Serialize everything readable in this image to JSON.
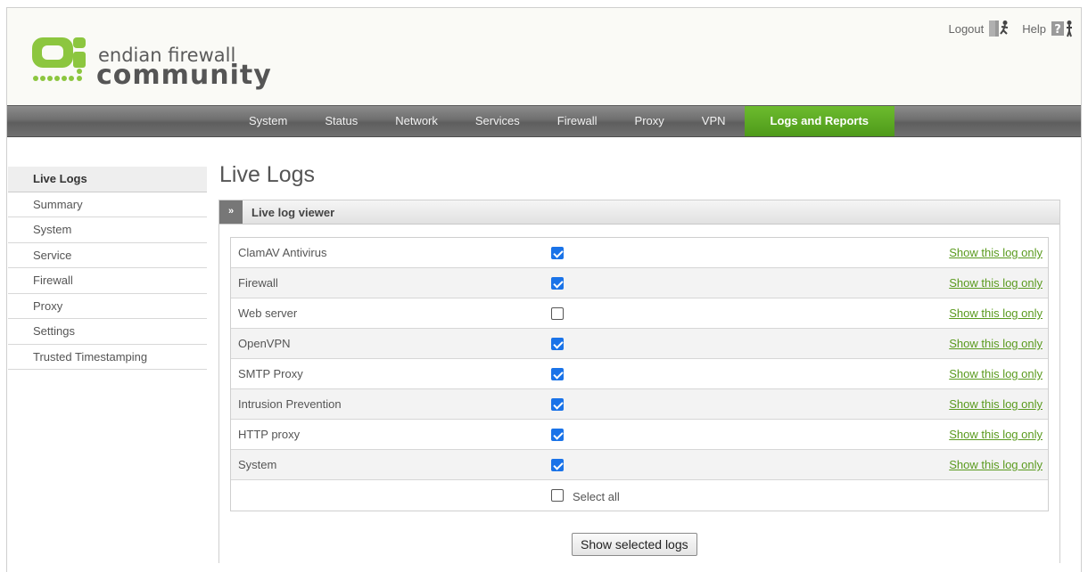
{
  "header": {
    "logo_line1": "endian firewall",
    "logo_line2": "community",
    "logout_label": "Logout",
    "help_label": "Help",
    "logout_icon": "exit-door-icon",
    "help_icon": "help-question-icon"
  },
  "nav": {
    "items": [
      {
        "label": "System"
      },
      {
        "label": "Status"
      },
      {
        "label": "Network"
      },
      {
        "label": "Services"
      },
      {
        "label": "Firewall"
      },
      {
        "label": "Proxy"
      },
      {
        "label": "VPN"
      },
      {
        "label": "Logs and Reports",
        "active": true
      }
    ],
    "active_color": "#5aa522"
  },
  "sidebar": {
    "items": [
      {
        "label": "Live Logs",
        "active": true
      },
      {
        "label": "Summary"
      },
      {
        "label": "System"
      },
      {
        "label": "Service"
      },
      {
        "label": "Firewall"
      },
      {
        "label": "Proxy"
      },
      {
        "label": "Settings"
      },
      {
        "label": "Trusted Timestamping"
      }
    ]
  },
  "main": {
    "title": "Live Logs",
    "panel_title": "Live log viewer",
    "panel_toggle": "»",
    "link_label": "Show this log only",
    "logs": [
      {
        "name": "ClamAV Antivirus",
        "checked": true
      },
      {
        "name": "Firewall",
        "checked": true
      },
      {
        "name": "Web server",
        "checked": false
      },
      {
        "name": "OpenVPN",
        "checked": true
      },
      {
        "name": "SMTP Proxy",
        "checked": true
      },
      {
        "name": "Intrusion Prevention",
        "checked": true
      },
      {
        "name": "HTTP proxy",
        "checked": true
      },
      {
        "name": "System",
        "checked": true
      }
    ],
    "select_all_label": "Select all",
    "select_all_checked": false,
    "submit_label": "Show selected logs"
  },
  "colors": {
    "link_green": "#5a9a1e",
    "checkbox_blue": "#1a73e8",
    "logo_green": "#8cc63f"
  }
}
